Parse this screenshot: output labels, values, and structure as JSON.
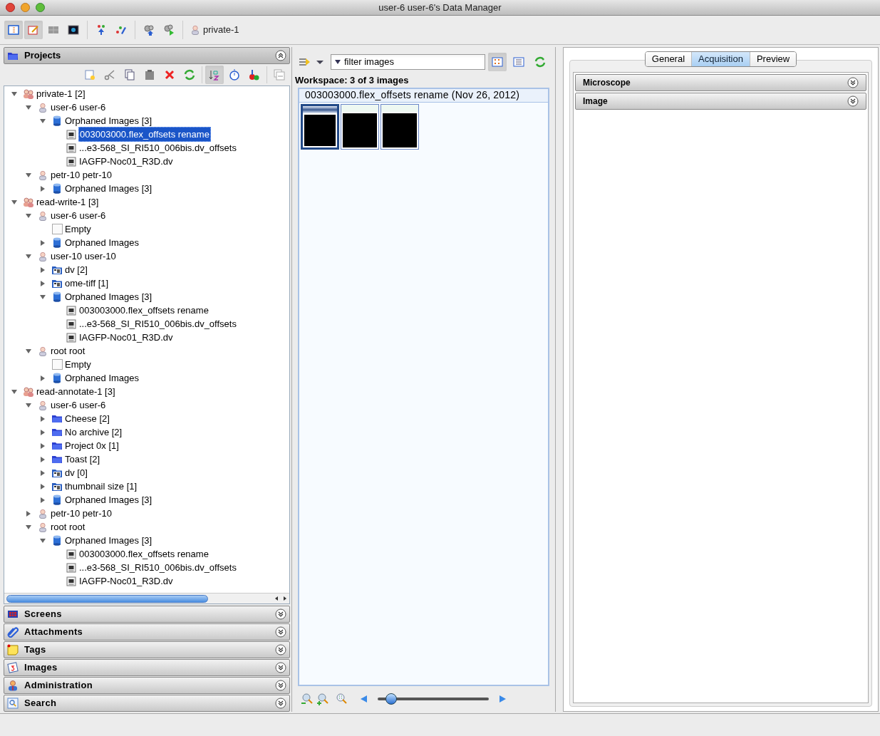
{
  "window": {
    "title": "user-6 user-6's Data Manager"
  },
  "toolbar": {
    "context": "private-1"
  },
  "projects": {
    "title": "Projects",
    "expanded": true,
    "tree": [
      {
        "label": "private-1 [2]",
        "kind": "group",
        "expanded": true,
        "selected": false,
        "children": [
          {
            "label": "user-6 user-6",
            "kind": "user",
            "expanded": true,
            "selected": false,
            "children": [
              {
                "label": "Orphaned Images [3]",
                "kind": "orphaned",
                "expanded": true,
                "selected": false,
                "children": [
                  {
                    "label": "003003000.flex_offsets rename",
                    "kind": "image",
                    "selected": true
                  },
                  {
                    "label": "...e3-568_SI_RI510_006bis.dv_offsets",
                    "kind": "image",
                    "selected": false
                  },
                  {
                    "label": "IAGFP-Noc01_R3D.dv",
                    "kind": "image",
                    "selected": false
                  }
                ]
              }
            ]
          },
          {
            "label": "petr-10 petr-10",
            "kind": "user",
            "expanded": true,
            "selected": false,
            "children": [
              {
                "label": "Orphaned Images [3]",
                "kind": "orphaned",
                "expanded": false,
                "selected": false
              }
            ]
          }
        ]
      },
      {
        "label": "read-write-1 [3]",
        "kind": "group",
        "expanded": true,
        "selected": false,
        "children": [
          {
            "label": "user-6 user-6",
            "kind": "user",
            "expanded": true,
            "selected": false,
            "children": [
              {
                "label": "Empty",
                "kind": "empty",
                "selected": false
              },
              {
                "label": "Orphaned Images",
                "kind": "orphaned",
                "expanded": false,
                "selected": false
              }
            ]
          },
          {
            "label": "user-10 user-10",
            "kind": "user",
            "expanded": true,
            "selected": false,
            "children": [
              {
                "label": "dv [2]",
                "kind": "dataset",
                "expanded": false,
                "selected": false
              },
              {
                "label": "ome-tiff [1]",
                "kind": "dataset",
                "expanded": false,
                "selected": false
              },
              {
                "label": "Orphaned Images [3]",
                "kind": "orphaned",
                "expanded": true,
                "selected": false,
                "children": [
                  {
                    "label": "003003000.flex_offsets rename",
                    "kind": "image",
                    "selected": false
                  },
                  {
                    "label": "...e3-568_SI_RI510_006bis.dv_offsets",
                    "kind": "image",
                    "selected": false
                  },
                  {
                    "label": "IAGFP-Noc01_R3D.dv",
                    "kind": "image",
                    "selected": false
                  }
                ]
              }
            ]
          },
          {
            "label": "root root",
            "kind": "user",
            "expanded": true,
            "selected": false,
            "children": [
              {
                "label": "Empty",
                "kind": "empty",
                "selected": false
              },
              {
                "label": "Orphaned Images",
                "kind": "orphaned",
                "expanded": false,
                "selected": false
              }
            ]
          }
        ]
      },
      {
        "label": "read-annotate-1 [3]",
        "kind": "group",
        "expanded": true,
        "selected": false,
        "children": [
          {
            "label": "user-6 user-6",
            "kind": "user",
            "expanded": true,
            "selected": false,
            "children": [
              {
                "label": "Cheese [2]",
                "kind": "project",
                "expanded": false,
                "selected": false
              },
              {
                "label": "No archive [2]",
                "kind": "project",
                "expanded": false,
                "selected": false
              },
              {
                "label": "Project 0x [1]",
                "kind": "project",
                "expanded": false,
                "selected": false
              },
              {
                "label": "Toast [2]",
                "kind": "project",
                "expanded": false,
                "selected": false
              },
              {
                "label": "dv [0]",
                "kind": "dataset",
                "expanded": false,
                "selected": false
              },
              {
                "label": "thumbnail size [1]",
                "kind": "dataset",
                "expanded": false,
                "selected": false
              },
              {
                "label": "Orphaned Images [3]",
                "kind": "orphaned",
                "expanded": false,
                "selected": false
              }
            ]
          },
          {
            "label": "petr-10 petr-10",
            "kind": "user",
            "expanded": false,
            "selected": false
          },
          {
            "label": "root root",
            "kind": "user",
            "expanded": true,
            "selected": false,
            "children": [
              {
                "label": "Orphaned Images [3]",
                "kind": "orphaned",
                "expanded": true,
                "selected": false,
                "children": [
                  {
                    "label": "003003000.flex_offsets rename",
                    "kind": "image",
                    "selected": false
                  },
                  {
                    "label": "...e3-568_SI_RI510_006bis.dv_offsets",
                    "kind": "image",
                    "selected": false
                  },
                  {
                    "label": "IAGFP-Noc01_R3D.dv",
                    "kind": "image",
                    "selected": false
                  }
                ]
              }
            ]
          }
        ]
      }
    ]
  },
  "sections": [
    {
      "title": "Screens",
      "kind": "screens",
      "expanded": false
    },
    {
      "title": "Attachments",
      "kind": "attachments",
      "expanded": false
    },
    {
      "title": "Tags",
      "kind": "tags",
      "expanded": false
    },
    {
      "title": "Images",
      "kind": "images",
      "expanded": false
    },
    {
      "title": "Administration",
      "kind": "administration",
      "expanded": false
    },
    {
      "title": "Search",
      "kind": "search",
      "expanded": false
    }
  ],
  "workspace": {
    "filter": "filter  images",
    "heading": "Workspace: 3 of 3 images",
    "group_title": "003003000.flex_offsets rename (Nov 26, 2012)",
    "thumbnails": [
      {
        "selected": true
      },
      {
        "selected": false
      },
      {
        "selected": false
      }
    ],
    "zoom": {
      "level": 0.12
    }
  },
  "metadata": {
    "tabs": [
      {
        "label": "General",
        "selected": false
      },
      {
        "label": "Acquisition",
        "selected": true
      },
      {
        "label": "Preview",
        "selected": false
      }
    ],
    "panes": [
      {
        "title": "Microscope",
        "expanded": false
      },
      {
        "title": "Image",
        "expanded": false
      }
    ]
  }
}
